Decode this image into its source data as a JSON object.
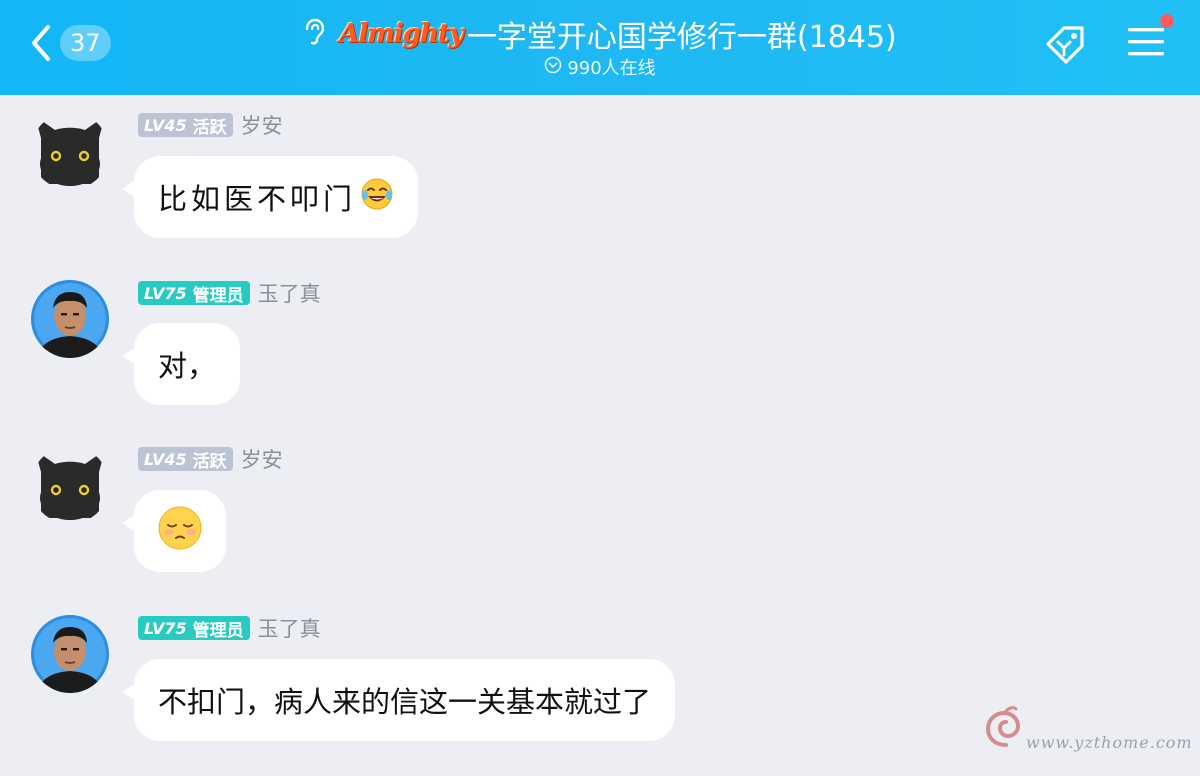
{
  "header": {
    "back_count": "37",
    "brand_text": "Almighty",
    "group_title": "一字堂开心国学修行一群(1845)",
    "online_text": "990人在线"
  },
  "messages": [
    {
      "level": "LV45",
      "role": "活跃",
      "nick": "岁安",
      "text": "比如医不叩门",
      "emoji": "laughing-tears"
    },
    {
      "level": "LV75",
      "role": "管理员",
      "nick": "玉了真",
      "text": "对，",
      "emoji": ""
    },
    {
      "level": "LV45",
      "role": "活跃",
      "nick": "岁安",
      "text": "",
      "emoji": "pensive-face"
    },
    {
      "level": "LV75",
      "role": "管理员",
      "nick": "玉了真",
      "text": "不扣门，病人来的信这一关基本就过了",
      "emoji": ""
    }
  ],
  "watermark": {
    "text": "www.yzthome.com"
  },
  "colors": {
    "header": "#12b7f5",
    "active_badge": "#bcc3d4",
    "admin_badge": "#27cbc2",
    "background": "#eceef3"
  }
}
